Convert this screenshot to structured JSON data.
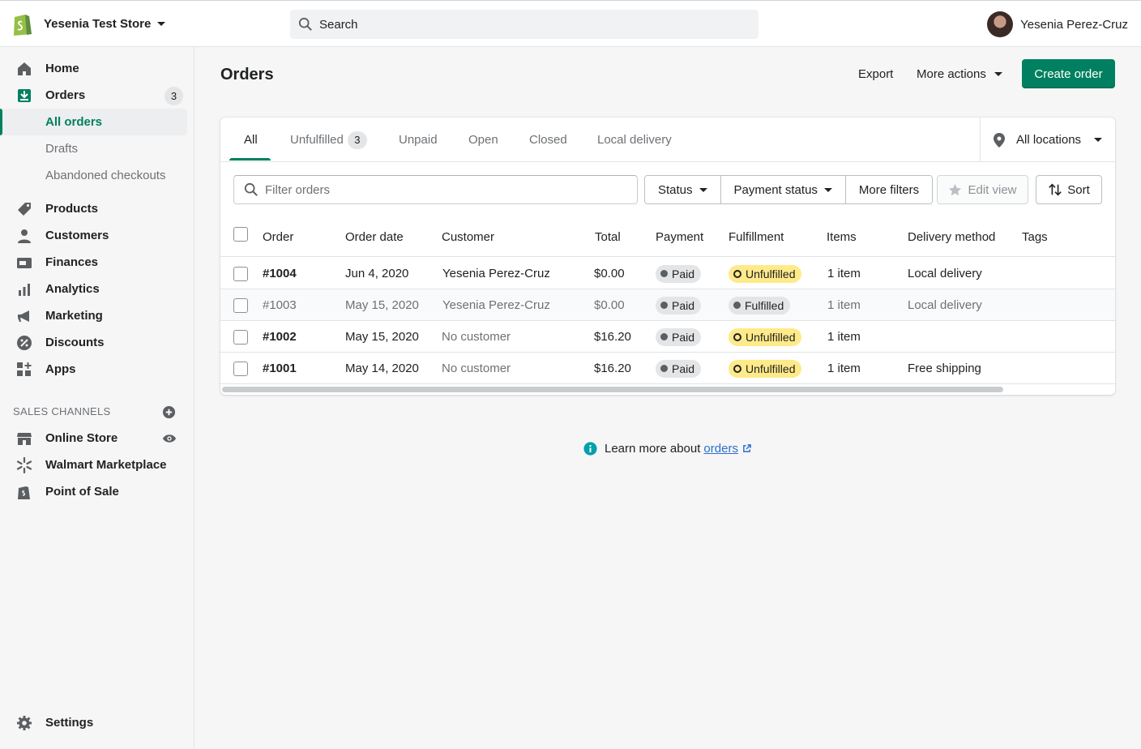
{
  "topbar": {
    "store_name": "Yesenia Test Store",
    "search_placeholder": "Search",
    "user_name": "Yesenia Perez-Cruz"
  },
  "sidebar": {
    "items": [
      {
        "label": "Home",
        "icon": "home-icon"
      },
      {
        "label": "Orders",
        "icon": "orders-icon",
        "count": "3"
      },
      {
        "label": "All orders",
        "active": true
      },
      {
        "label": "Drafts"
      },
      {
        "label": "Abandoned checkouts"
      },
      {
        "label": "Products",
        "icon": "tag-icon"
      },
      {
        "label": "Customers",
        "icon": "person-icon"
      },
      {
        "label": "Finances",
        "icon": "finances-icon"
      },
      {
        "label": "Analytics",
        "icon": "bar-chart-icon"
      },
      {
        "label": "Marketing",
        "icon": "megaphone-icon"
      },
      {
        "label": "Discounts",
        "icon": "discount-icon"
      },
      {
        "label": "Apps",
        "icon": "apps-icon"
      }
    ],
    "sales_channels_title": "SALES CHANNELS",
    "channels": [
      {
        "label": "Online Store",
        "icon": "store-icon"
      },
      {
        "label": "Walmart Marketplace",
        "icon": "spark-icon"
      },
      {
        "label": "Point of Sale",
        "icon": "bag-icon"
      }
    ],
    "settings_label": "Settings"
  },
  "page": {
    "title": "Orders",
    "export_label": "Export",
    "more_actions_label": "More actions",
    "create_order_label": "Create order"
  },
  "tabs": [
    {
      "label": "All",
      "active": true
    },
    {
      "label": "Unfulfilled",
      "count": "3"
    },
    {
      "label": "Unpaid"
    },
    {
      "label": "Open"
    },
    {
      "label": "Closed"
    },
    {
      "label": "Local delivery"
    }
  ],
  "location_select": "All locations",
  "filters": {
    "placeholder": "Filter orders",
    "status_label": "Status",
    "payment_status_label": "Payment status",
    "more_filters_label": "More filters",
    "edit_view_label": "Edit view",
    "sort_label": "Sort"
  },
  "table": {
    "columns": [
      "Order",
      "Order date",
      "Customer",
      "Total",
      "Payment",
      "Fulfillment",
      "Items",
      "Delivery method",
      "Tags"
    ],
    "rows": [
      {
        "order": "#1004",
        "date": "Jun 4, 2020",
        "customer": "Yesenia Perez-Cruz",
        "total": "$0.00",
        "payment": "Paid",
        "fulfillment": "Unfulfilled",
        "items": "1 item",
        "delivery": "Local delivery",
        "tags": ""
      },
      {
        "order": "#1003",
        "date": "May 15, 2020",
        "customer": "Yesenia Perez-Cruz",
        "total": "$0.00",
        "payment": "Paid",
        "fulfillment": "Fulfilled",
        "items": "1 item",
        "delivery": "Local delivery",
        "tags": ""
      },
      {
        "order": "#1002",
        "date": "May 15, 2020",
        "customer": "No customer",
        "total": "$16.20",
        "payment": "Paid",
        "fulfillment": "Unfulfilled",
        "items": "1 item",
        "delivery": "",
        "tags": ""
      },
      {
        "order": "#1001",
        "date": "May 14, 2020",
        "customer": "No customer",
        "total": "$16.20",
        "payment": "Paid",
        "fulfillment": "Unfulfilled",
        "items": "1 item",
        "delivery": "Free shipping",
        "tags": ""
      }
    ]
  },
  "footer": {
    "learn_text": "Learn more about",
    "learn_link": "orders"
  },
  "colors": {
    "primary": "#008060",
    "unfulfilled_badge": "#ffea8a",
    "link": "#2c6ecb"
  }
}
